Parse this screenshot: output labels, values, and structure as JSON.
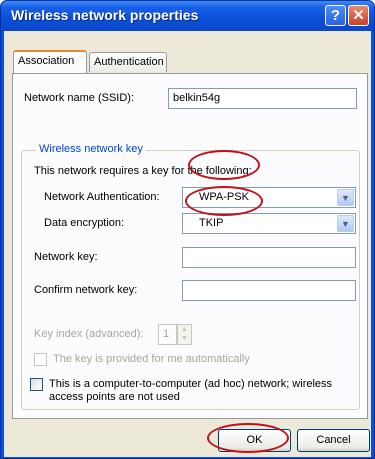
{
  "window": {
    "title": "Wireless network properties",
    "help_glyph": "?",
    "close_glyph": "✕"
  },
  "tabs": [
    {
      "label": "Association",
      "active": true
    },
    {
      "label": "Authentication",
      "active": false
    }
  ],
  "ssid": {
    "label": "Network name (SSID):",
    "value": "belkin54g"
  },
  "key_group": {
    "legend": "Wireless network key",
    "intro": "This network requires a key for the following:",
    "auth": {
      "label": "Network Authentication:",
      "value": "WPA-PSK"
    },
    "encryption": {
      "label": "Data encryption:",
      "value": "TKIP"
    },
    "network_key": {
      "label": "Network key:",
      "value": ""
    },
    "confirm_key": {
      "label": "Confirm network key:",
      "value": ""
    },
    "key_index": {
      "label": "Key index (advanced):",
      "value": "1"
    },
    "auto_key": {
      "label": "The key is provided for me automatically",
      "checked": false,
      "disabled": true
    }
  },
  "adhoc": {
    "label_line1": "This is a computer-to-computer (ad hoc) network; wireless",
    "label_line2": "access points are not used",
    "checked": false
  },
  "buttons": {
    "ok": "OK",
    "cancel": "Cancel"
  },
  "colors": {
    "title_bar": "#0b4fd8",
    "highlight_circle": "#c0101a",
    "group_legend": "#0046d5"
  }
}
